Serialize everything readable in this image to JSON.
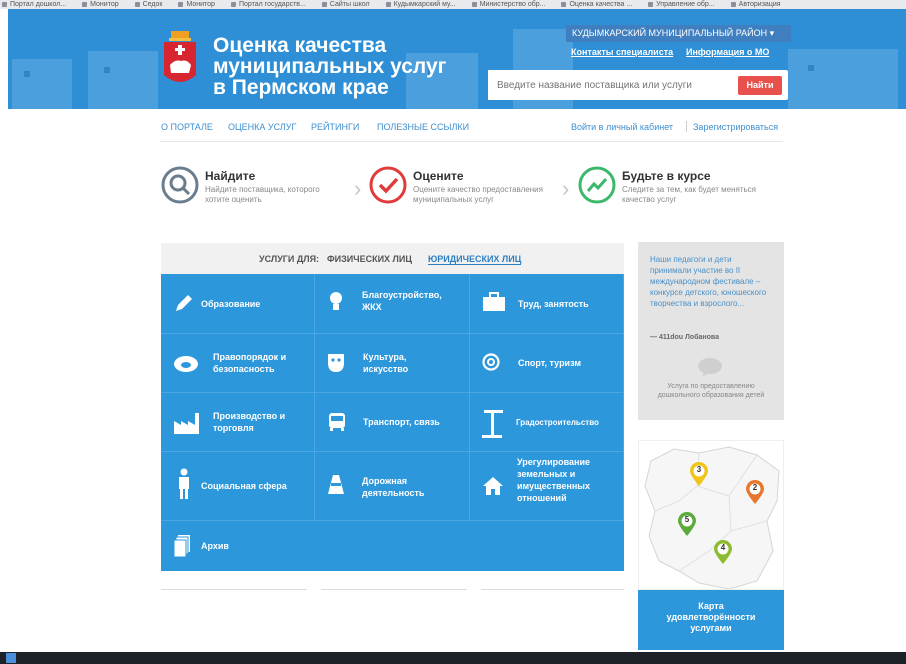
{
  "bookmarks": [
    "Портал дошкол...",
    "Монитор",
    "Седок",
    "Монитор",
    "Портал государств...",
    "Сайты школ",
    "Кудымкарский му...",
    "Министерство обр...",
    "Оценка качества ...",
    "Управление обр...",
    "Авторизация"
  ],
  "header": {
    "title_line1": "Оценка качества",
    "title_line2": "муниципальных услуг",
    "title_line3": "в Пермском крае",
    "region": "КУДЫМКАРСКИЙ МУНИЦИПАЛЬНЫЙ РАЙОН ▾",
    "contacts": "Контакты специалиста",
    "mo_info": "Информация о МО",
    "search_placeholder": "Введите название поставщика или услуги",
    "search_button": "Найти"
  },
  "nav": {
    "about": "О ПОРТАЛЕ",
    "rate": "ОЦЕНКА УСЛУГ",
    "ratings": "РЕЙТИНГИ",
    "links": "ПОЛЕЗНЫЕ ССЫЛКИ",
    "login": "Войти в личный кабинет",
    "register": "Зарегистрироваться"
  },
  "steps": [
    {
      "title": "Найдите",
      "desc": "Найдите поставщика, которого хотите оценить"
    },
    {
      "title": "Оцените",
      "desc": "Оцените качество предоставления муниципальных услуг"
    },
    {
      "title": "Будьте в курсе",
      "desc": "Следите за тем, как будет меняться качество услуг"
    }
  ],
  "services": {
    "for_label": "УСЛУГИ ДЛЯ:",
    "tab_individuals": "ФИЗИЧЕСКИХ ЛИЦ",
    "tab_legal": "ЮРИДИЧЕСКИХ ЛИЦ",
    "items": [
      {
        "l1": "Образование",
        "l2": ""
      },
      {
        "l1": "Благоустройство,",
        "l2": "ЖКХ"
      },
      {
        "l1": "Труд, занятость",
        "l2": ""
      },
      {
        "l1": "Правопорядок и",
        "l2": "безопасность"
      },
      {
        "l1": "Культура,",
        "l2": "искусство"
      },
      {
        "l1": "Спорт, туризм",
        "l2": ""
      },
      {
        "l1": "Производство и",
        "l2": "торговля"
      },
      {
        "l1": "Транспорт, связь",
        "l2": ""
      },
      {
        "l1": "Градостроительство",
        "l2": ""
      },
      {
        "l1": "Социальная сфера",
        "l2": ""
      },
      {
        "l1": "Дорожная",
        "l2": "деятельность"
      },
      {
        "l1": "Урегулирование",
        "l2": "земельных и",
        "l3": "имущественных",
        "l4": "отношений"
      },
      {
        "l1": "Архив",
        "l2": ""
      }
    ]
  },
  "news": {
    "text": "Наши педагоги и дети принимали участие во II международном фестивале – конкурсе детского, юношеского творчества и взрослого...",
    "author": "— 411dou Лобанова",
    "service": "Услуга по предоставлению дошкольного образования детей"
  },
  "map": {
    "markers": [
      "3",
      "2",
      "5",
      "4"
    ],
    "caption_l1": "Карта",
    "caption_l2": "удовлетворённости",
    "caption_l3": "услугами"
  },
  "colors": {
    "header": "#2e8fd6",
    "accent": "#2d97dc",
    "button": "#e8504c"
  }
}
